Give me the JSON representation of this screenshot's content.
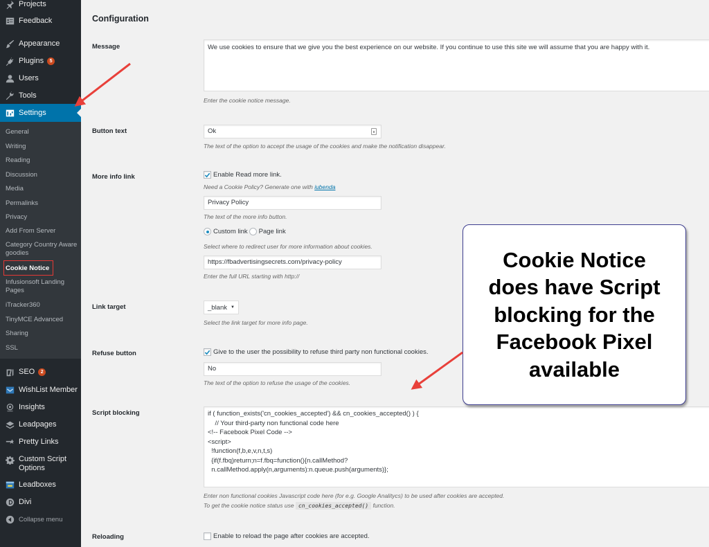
{
  "sidebar": {
    "menu": [
      {
        "label": "Projects",
        "icon": "pin-icon"
      },
      {
        "label": "Feedback",
        "icon": "feedback-icon"
      },
      {
        "label": "Appearance",
        "icon": "paintbrush-icon"
      },
      {
        "label": "Plugins",
        "icon": "plugin-icon",
        "badge": "5"
      },
      {
        "label": "Users",
        "icon": "user-icon"
      },
      {
        "label": "Tools",
        "icon": "wrench-icon"
      },
      {
        "label": "Settings",
        "icon": "settings-icon",
        "active": true
      }
    ],
    "submenu": [
      "General",
      "Writing",
      "Reading",
      "Discussion",
      "Media",
      "Permalinks",
      "Privacy",
      "Add From Server",
      "Category Country Aware goodies",
      "Cookie Notice",
      "Infusionsoft Landing Pages",
      "iTracker360",
      "TinyMCE Advanced",
      "Sharing",
      "SSL"
    ],
    "current_submenu": "Cookie Notice",
    "menu2": [
      {
        "label": "SEO",
        "icon": "yoast-icon",
        "badge": "2"
      },
      {
        "label": "WishList Member",
        "icon": "wishlist-icon"
      },
      {
        "label": "Insights",
        "icon": "insights-icon"
      },
      {
        "label": "Leadpages",
        "icon": "leadpages-icon"
      },
      {
        "label": "Pretty Links",
        "icon": "pretty-links-icon"
      },
      {
        "label": "Custom Script Options",
        "icon": "gear-icon"
      },
      {
        "label": "Leadboxes",
        "icon": "leadboxes-icon"
      },
      {
        "label": "Divi",
        "icon": "divi-icon"
      }
    ],
    "collapse_label": "Collapse menu"
  },
  "main": {
    "section_title": "Configuration",
    "message": {
      "label": "Message",
      "value": "We use cookies to ensure that we give you the best experience on our website. If you continue to use this site we will assume that you are happy with it.",
      "desc": "Enter the cookie notice message."
    },
    "button_text": {
      "label": "Button text",
      "value": "Ok",
      "desc": "The text of the option to accept the usage of the cookies and make the notification disappear."
    },
    "more_info": {
      "label": "More info link",
      "checkbox_label": "Enable Read more link.",
      "checked": true,
      "policy_prefix": "Need a Cookie Policy? Generate one with ",
      "policy_link": "iubenda",
      "text_value": "Privacy Policy",
      "text_desc": "The text of the more info button.",
      "radio_options": [
        "Custom link",
        "Page link"
      ],
      "radio_selected": "Custom link",
      "radio_desc": "Select where to redirect user for more information about cookies.",
      "url_value": "https://fbadvertisingsecrets.com/privacy-policy",
      "url_desc": "Enter the full URL starting with http://"
    },
    "link_target": {
      "label": "Link target",
      "value": "_blank",
      "desc": "Select the link target for more info page."
    },
    "refuse": {
      "label": "Refuse button",
      "checkbox_label": "Give to the user the possibility to refuse third party non functional cookies.",
      "checked": true,
      "value": "No",
      "desc": "The text of the option to refuse the usage of the cookies."
    },
    "script_blocking": {
      "label": "Script blocking",
      "code_lines": [
        "if ( function_exists('cn_cookies_accepted') && cn_cookies_accepted() ) {",
        "    // Your third-party non functional code here",
        "",
        "<!-- Facebook Pixel Code -->",
        "<script>",
        "  !function(f,b,e,v,n,t,s)",
        "  {if(f.fbq)return;n=f.fbq=function(){n.callMethod?",
        "  n.callMethod.apply(n,arguments):n.queue.push(arguments)};"
      ],
      "desc1": "Enter non functional cookies Javascript code here (for e.g. Google Analitycs) to be used after cookies are accepted.",
      "desc2_prefix": "To get the cookie notice status use ",
      "desc2_code": "cn_cookies_accepted()",
      "desc2_suffix": " function."
    },
    "reloading": {
      "label": "Reloading",
      "checkbox_label": "Enable to reload the page after cookies are accepted.",
      "checked": false
    }
  },
  "annotation": {
    "callout_text": "Cookie Notice does have Script blocking for the Facebook Pixel available",
    "arrow_color": "#e8403a",
    "border_color": "#3d3d8f"
  },
  "colors": {
    "sidebar_bg": "#23282d",
    "submenu_bg": "#32373c",
    "active_bg": "#0073aa",
    "badge_bg": "#ca4a1f",
    "page_bg": "#f1f1f1"
  }
}
